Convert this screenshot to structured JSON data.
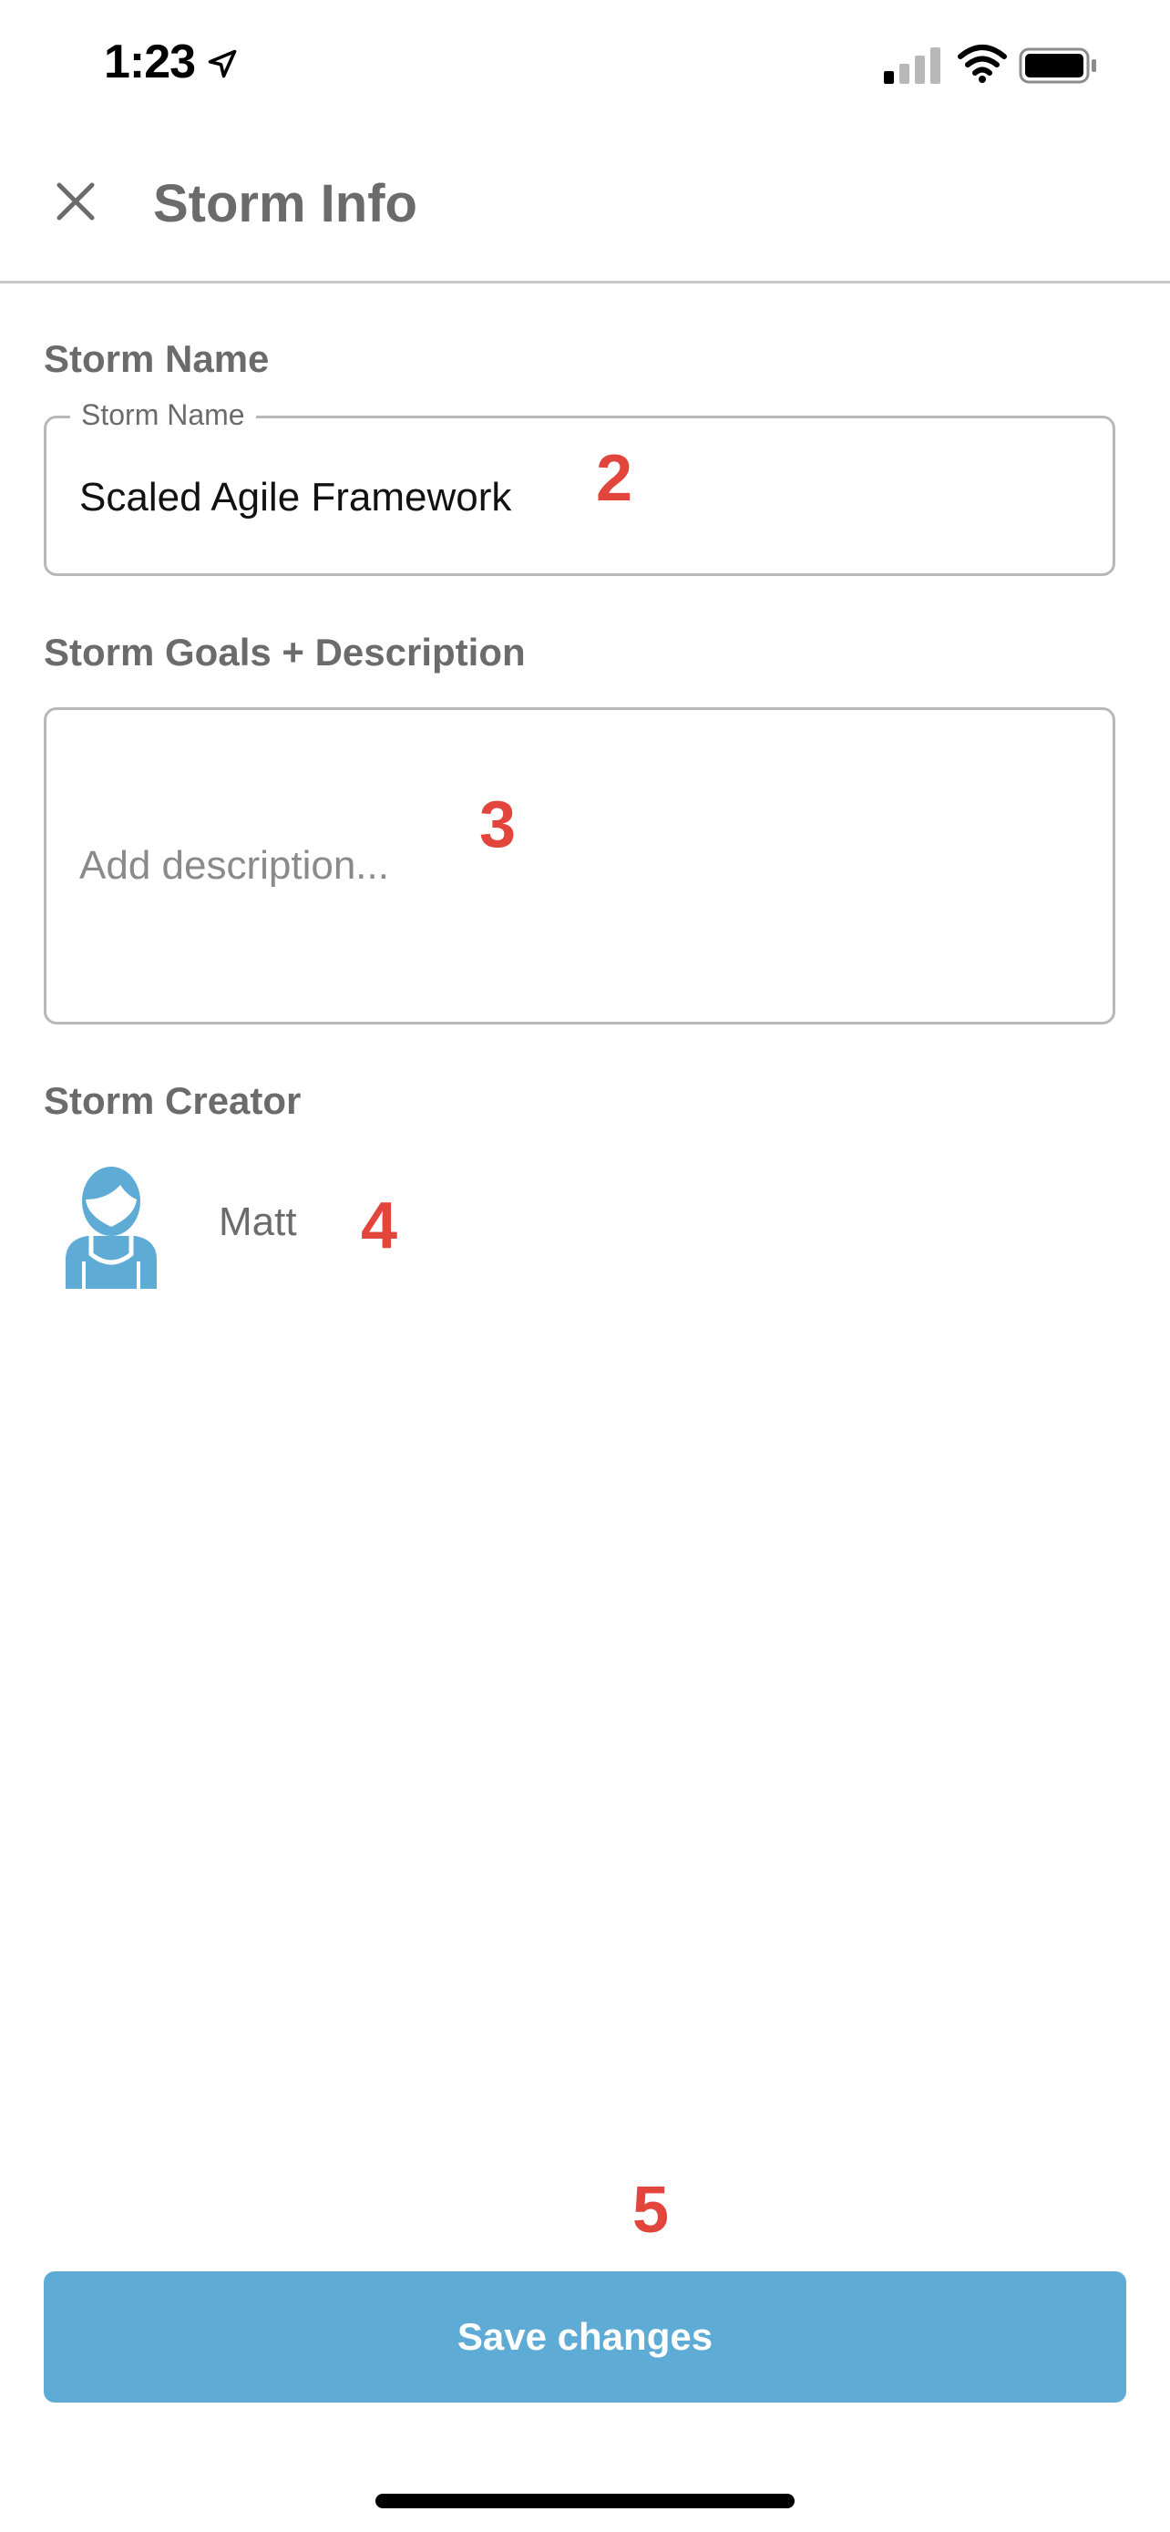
{
  "status_bar": {
    "time": "1:23",
    "icons": [
      "location-arrow-icon",
      "cellular-signal-icon",
      "wifi-icon",
      "battery-icon"
    ]
  },
  "header": {
    "title": "Storm Info",
    "close_icon": "close-icon"
  },
  "storm_name": {
    "section_label": "Storm Name",
    "field_label": "Storm Name",
    "value": "Scaled Agile Framework"
  },
  "description": {
    "section_label": "Storm Goals + Description",
    "placeholder": "Add description..."
  },
  "creator": {
    "section_label": "Storm Creator",
    "name": "Matt",
    "avatar_icon": "user-avatar-icon"
  },
  "annotations": {
    "a2": "2",
    "a3": "3",
    "a4": "4",
    "a5": "5"
  },
  "actions": {
    "save_label": "Save changes"
  },
  "colors": {
    "accent": "#5eacd6",
    "annotation": "#e2453c",
    "text": "#6b6b6b"
  }
}
